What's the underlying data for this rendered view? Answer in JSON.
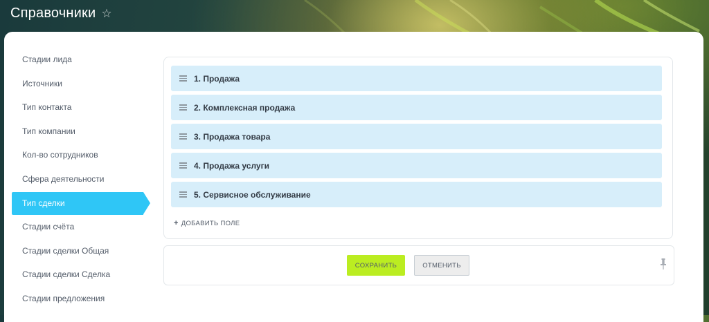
{
  "header": {
    "title": "Справочники",
    "favorite_icon": "star-outline-icon"
  },
  "sidebar": {
    "items": [
      {
        "label": "Стадии лида"
      },
      {
        "label": "Источники"
      },
      {
        "label": "Тип контакта"
      },
      {
        "label": "Тип компании"
      },
      {
        "label": "Кол-во сотрудников"
      },
      {
        "label": "Сфера деятельности"
      },
      {
        "label": "Тип сделки",
        "active": true
      },
      {
        "label": "Стадии счёта"
      },
      {
        "label": "Стадии сделки Общая"
      },
      {
        "label": "Стадии сделки Сделка"
      },
      {
        "label": "Стадии предложения"
      }
    ]
  },
  "list": {
    "items": [
      {
        "label": "1. Продажа"
      },
      {
        "label": "2. Комплексная продажа"
      },
      {
        "label": "3. Продажа товара"
      },
      {
        "label": "4. Продажа услуги"
      },
      {
        "label": "5. Сервисное обслуживание"
      }
    ],
    "add_label": "добавить поле"
  },
  "actions": {
    "save_label": "Сохранить",
    "cancel_label": "Отменить"
  },
  "colors": {
    "accent": "#2fc6f6",
    "item_bg": "#d7eefa",
    "save_bg": "#bbed21",
    "cancel_bg": "#ededed"
  }
}
